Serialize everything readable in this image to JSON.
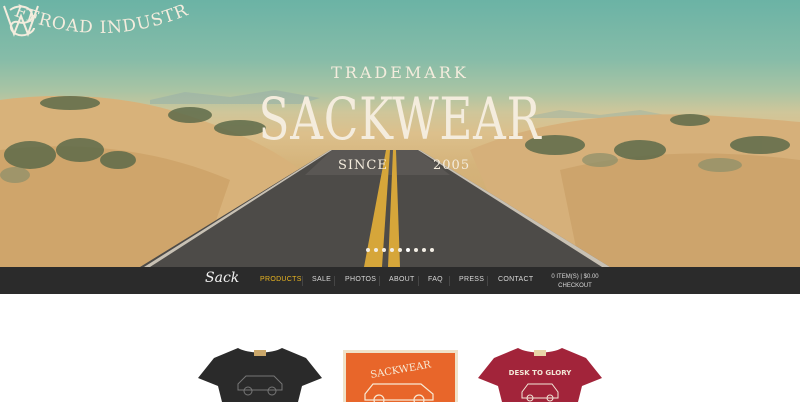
{
  "hero": {
    "trademark": "TRADEMARK",
    "brand": "SACKWEAR",
    "since_label": "SINCE",
    "since_year": "2005",
    "tagline": "OFFROAD INDUSTRY",
    "slide_count": 9,
    "active_slide": 5
  },
  "nav": {
    "logo": "Sack",
    "items": [
      "PRODUCTS",
      "SALE",
      "PHOTOS",
      "ABOUT",
      "FAQ",
      "PRESS",
      "CONTACT"
    ],
    "active": "PRODUCTS",
    "cart_summary": "0 ITEM(S) | $0.00",
    "checkout_label": "CHECKOUT",
    "active_color": "#e8b421",
    "bar_color": "#2b2b2b"
  },
  "products": [
    {
      "color": "#2a2a2a",
      "print_title": ""
    },
    {
      "color": "#e8662a",
      "print_title": "SACKWEAR"
    },
    {
      "color": "#a2243a",
      "print_title": "DESK TO GLORY"
    }
  ]
}
